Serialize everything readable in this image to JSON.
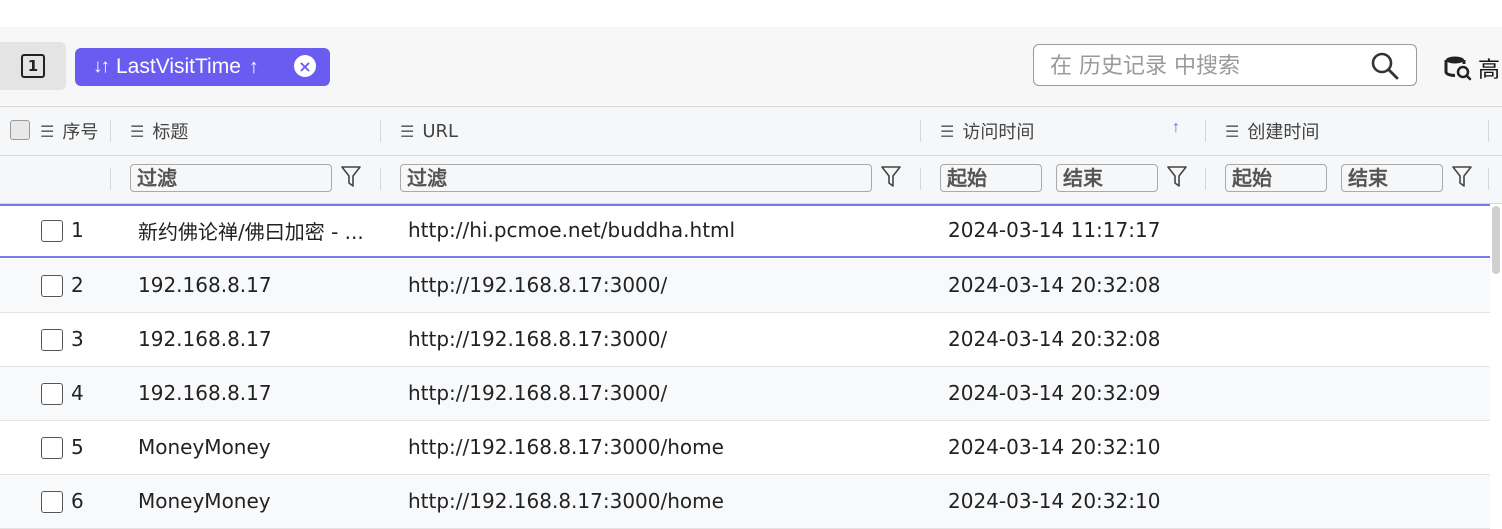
{
  "toolbar": {
    "page_indicator": "1",
    "sort_chip": {
      "icon": "sort-icon",
      "field": "LastVisitTime",
      "direction": "↑",
      "remove": "×"
    },
    "search": {
      "placeholder": "在 历史记录 中搜索",
      "value": ""
    },
    "advanced_label": "高"
  },
  "columns": [
    {
      "key": "index",
      "label": "序号"
    },
    {
      "key": "title",
      "label": "标题"
    },
    {
      "key": "url",
      "label": "URL"
    },
    {
      "key": "visit_time",
      "label": "访问时间",
      "sorted": "asc"
    },
    {
      "key": "create_time",
      "label": "创建时间"
    }
  ],
  "filters": {
    "title_placeholder": "过滤",
    "url_placeholder": "过滤",
    "visit_start": "起始",
    "visit_end": "结束",
    "create_start": "起始",
    "create_end": "结束"
  },
  "rows": [
    {
      "index": "1",
      "title": "新约佛论禅/佛曰加密 - ...",
      "url": "http://hi.pcmoe.net/buddha.html",
      "visit_time": "2024-03-14 11:17:17",
      "create_time": ""
    },
    {
      "index": "2",
      "title": "192.168.8.17",
      "url": "http://192.168.8.17:3000/",
      "visit_time": "2024-03-14 20:32:08",
      "create_time": ""
    },
    {
      "index": "3",
      "title": "192.168.8.17",
      "url": "http://192.168.8.17:3000/",
      "visit_time": "2024-03-14 20:32:08",
      "create_time": ""
    },
    {
      "index": "4",
      "title": "192.168.8.17",
      "url": "http://192.168.8.17:3000/",
      "visit_time": "2024-03-14 20:32:09",
      "create_time": ""
    },
    {
      "index": "5",
      "title": "MoneyMoney",
      "url": "http://192.168.8.17:3000/home",
      "visit_time": "2024-03-14 20:32:10",
      "create_time": ""
    },
    {
      "index": "6",
      "title": "MoneyMoney",
      "url": "http://192.168.8.17:3000/home",
      "visit_time": "2024-03-14 20:32:10",
      "create_time": ""
    }
  ],
  "colors": {
    "accent": "#6a5cf0",
    "active_row_border": "#7b7be6",
    "header_bg": "#f6f7f8"
  }
}
